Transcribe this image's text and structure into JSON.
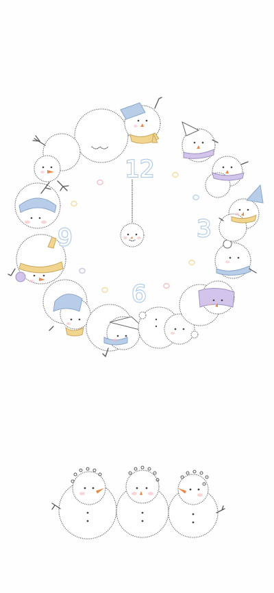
{
  "clock": {
    "numerals": [
      "12",
      "3",
      "6",
      "9"
    ],
    "numeral_color": "#a9c7ea",
    "dot_colors": [
      "#f2c2c6",
      "#f4dda2",
      "#bcd3ee",
      "#cfc6ea"
    ]
  },
  "palette": {
    "scarf_blue": "#b8cde8",
    "scarf_yellow": "#f1d58f",
    "scarf_purple": "#d2c4ea",
    "cheek_pink": "#f4b9bd",
    "nose_orange": "#e8894a",
    "line_gray": "#666666"
  },
  "icons": [
    "snowman-icon",
    "hand-drawn-clock-icon"
  ]
}
